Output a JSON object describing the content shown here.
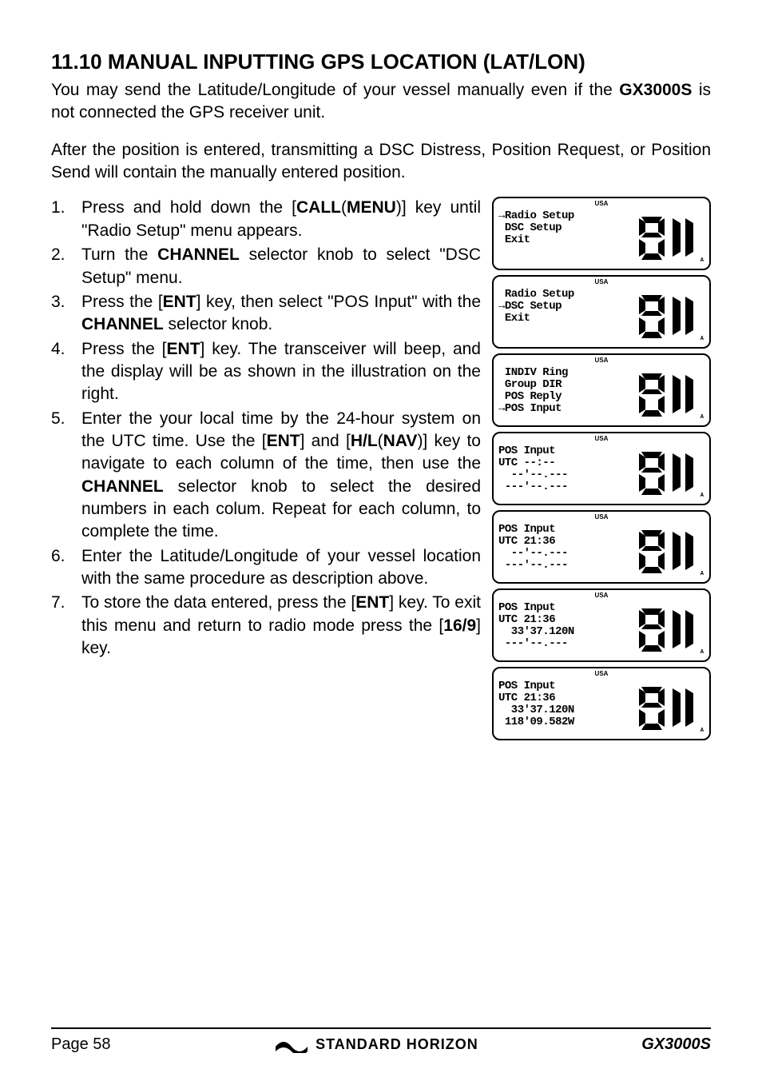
{
  "heading": "11.10  MANUAL INPUTTING GPS LOCATION (LAT/LON)",
  "intro_p1a": "You may send the Latitude/Longitude of your vessel manually even if the ",
  "intro_p1b": "GX3000S",
  "intro_p1c": " is not connected the GPS receiver unit.",
  "intro_p2": "After the position is entered, transmitting a DSC Distress, Position Request, or Position Send will contain the manually entered position.",
  "steps": [
    {
      "n": "1.",
      "a": "Press and hold down the [",
      "b": "CALL",
      "c": "(",
      "d": "MENU",
      "e": ")] key until \"",
      "f": "Radio Setup",
      "g": "\" menu appears."
    },
    {
      "n": "2.",
      "a": "Turn the ",
      "b": "CHANNEL",
      "c": " selector knob to select \"",
      "f": "DSC Setup",
      "g": "\" menu."
    },
    {
      "n": "3.",
      "a": "Press the [",
      "b": "ENT",
      "c": "] key, then select \"",
      "f": "POS Input",
      "g": "\" with the ",
      "h": "CHANNEL",
      "i": " selector knob."
    },
    {
      "n": "4.",
      "a": "Press the [",
      "b": "ENT",
      "c": "] key. The transceiver will beep, and the display will be as shown in the illustration on the right."
    },
    {
      "n": "5.",
      "a": "Enter the your local time by the 24-hour system on the UTC time. Use the [",
      "b": "ENT",
      "c": "] and [",
      "d": "H/L",
      "e": "(",
      "dd": "NAV",
      "ee": ")] key to navigate to each column of the time, then use the ",
      "h": "CHANNEL",
      "i": " selector knob to select the desired numbers in each colum. Repeat for each column, to complete the time."
    },
    {
      "n": "6.",
      "a": "Enter the Latitude/Longitude of your vessel location with the same procedure as description above."
    },
    {
      "n": "7.",
      "a": "To store the data entered, press the [",
      "b": "ENT",
      "c": "] key. To exit this menu and return to radio mode press the [",
      "d": "16/9",
      "e": "] key."
    }
  ],
  "lcd": [
    {
      "usa": "USA",
      "text": "→Radio Setup\n DSC Setup\n Exit"
    },
    {
      "usa": "USA",
      "text": " Radio Setup\n→DSC Setup\n Exit"
    },
    {
      "usa": "USA",
      "text": " INDIV Ring\n Group DIR\n POS Reply\n→POS Input"
    },
    {
      "usa": "USA",
      "text": "POS Input\nUTC --:--\n  --'--.---\n ---'--.---"
    },
    {
      "usa": "USA",
      "text": "POS Input\nUTC 21:36\n  --'--.---\n ---'--.---"
    },
    {
      "usa": "USA",
      "text": "POS Input\nUTC 21:36\n  33'37.120N\n ---'--.---"
    },
    {
      "usa": "USA",
      "text": "POS Input\nUTC 21:36\n  33'37.120N\n 118'09.582W"
    }
  ],
  "digit_A_suffix": "A",
  "footer": {
    "page": "Page 58",
    "brand": "STANDARD HORIZON",
    "model": "GX3000S"
  }
}
